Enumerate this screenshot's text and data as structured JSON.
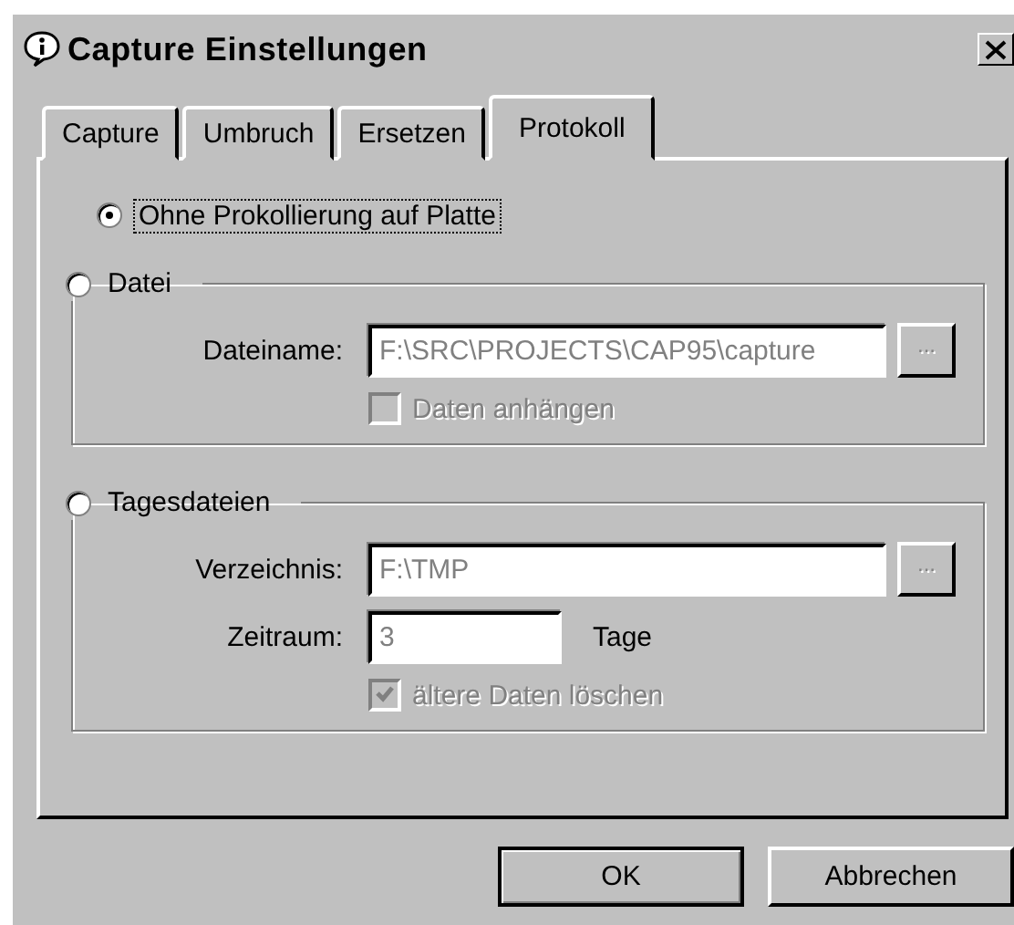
{
  "window": {
    "title": "Capture Einstellungen"
  },
  "tabs": [
    {
      "label": "Capture",
      "selected": false
    },
    {
      "label": "Umbruch",
      "selected": false
    },
    {
      "label": "Ersetzen",
      "selected": false
    },
    {
      "label": "Protokoll",
      "selected": true
    }
  ],
  "options": [
    {
      "label": "Ohne Prokollierung auf Platte",
      "selected": true,
      "focused": true
    }
  ],
  "groups": [
    {
      "label": "Datei",
      "selected": false,
      "fields": [
        {
          "kind": "path",
          "label": "Dateiname:",
          "value": "F:\\SRC\\PROJECTS\\CAP95\\capture",
          "browse": "...",
          "disabled": true
        }
      ],
      "checkbox": {
        "label": "Daten anhängen",
        "checked": false,
        "disabled": true
      }
    },
    {
      "label": "Tagesdateien",
      "selected": false,
      "fields": [
        {
          "kind": "path",
          "label": "Verzeichnis:",
          "value": "F:\\TMP",
          "browse": "...",
          "disabled": true
        },
        {
          "kind": "number",
          "label": "Zeitraum:",
          "value": "3",
          "unit": "Tage",
          "disabled": true
        }
      ],
      "checkbox": {
        "label": "ältere Daten löschen",
        "checked": true,
        "disabled": true
      }
    }
  ],
  "buttons": [
    {
      "label": "OK",
      "default": true
    },
    {
      "label": "Abbrechen",
      "default": false
    }
  ]
}
